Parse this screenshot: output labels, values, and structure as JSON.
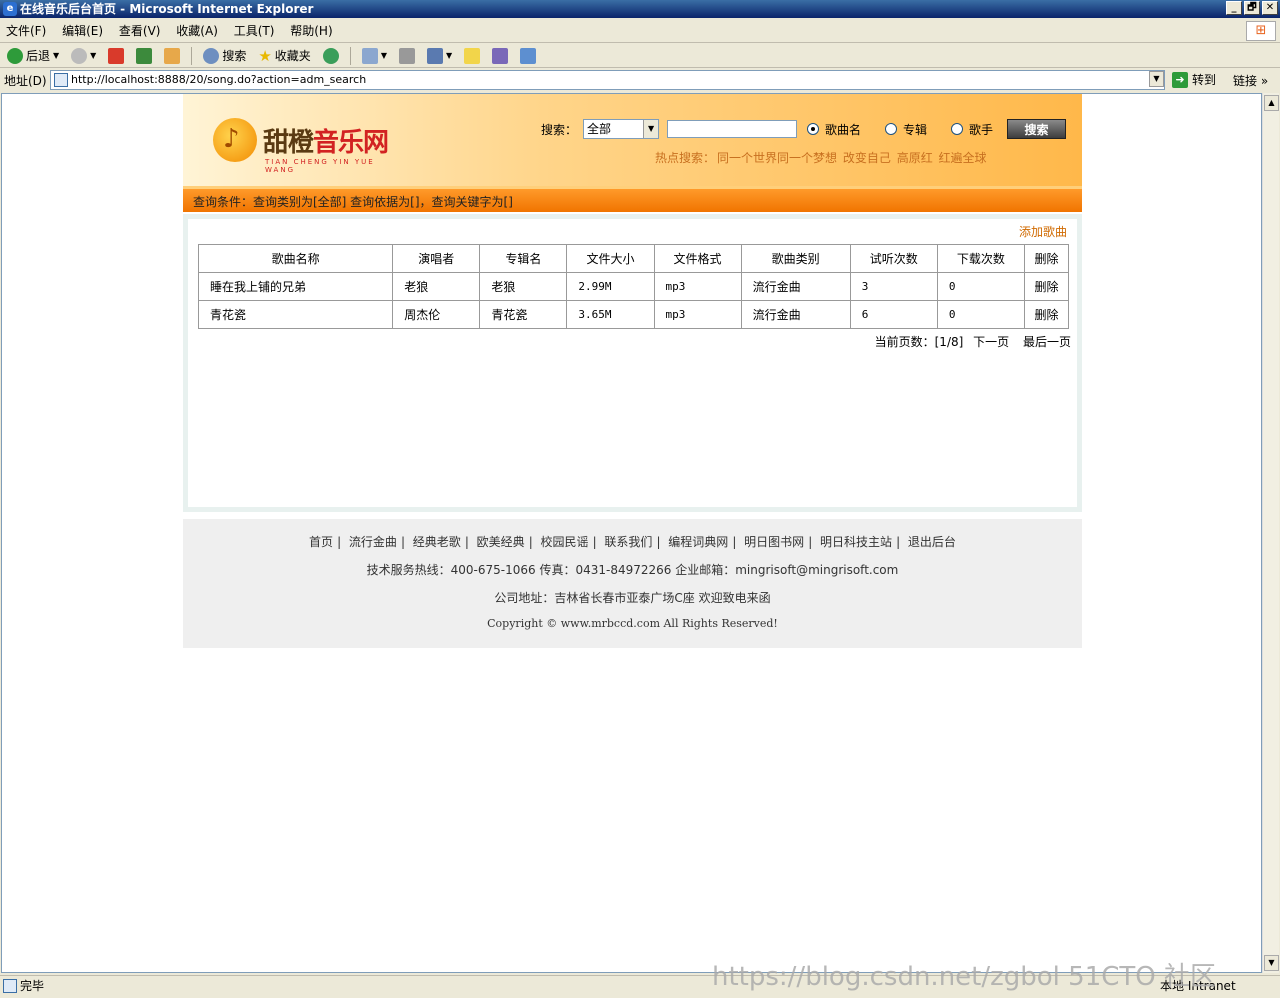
{
  "window": {
    "title": "在线音乐后台首页 - Microsoft Internet Explorer",
    "min_btn": "_",
    "max_btn": "🗗",
    "close_btn": "✕"
  },
  "menubar": [
    "文件(F)",
    "编辑(E)",
    "查看(V)",
    "收藏(A)",
    "工具(T)",
    "帮助(H)"
  ],
  "toolbar": {
    "back_label": "后退",
    "search_label": "搜索",
    "favorites_label": "收藏夹"
  },
  "addressbar": {
    "label": "地址(D)",
    "url": "http://localhost:8888/20/song.do?action=adm_search",
    "go_label": "转到",
    "links_label": "链接"
  },
  "header": {
    "logo_cn_1": "甜橙",
    "logo_cn_2": "音乐网",
    "logo_en": "TIAN CHENG YIN YUE WANG",
    "search_label": "搜索：",
    "select_value": "全部",
    "radio_song": "歌曲名",
    "radio_album": "专辑",
    "radio_singer": "歌手",
    "search_btn": "搜索",
    "hot_label": "热点搜索：",
    "hot_items": [
      "同一个世界同一个梦想",
      "改变自己",
      "高原红",
      "红遍全球"
    ]
  },
  "condition": "查询条件：查询类别为[全部] 查询依据为[]，查询关键字为[]",
  "add_link": "添加歌曲",
  "table": {
    "headers": [
      "歌曲名称",
      "演唱者",
      "专辑名",
      "文件大小",
      "文件格式",
      "歌曲类别",
      "试听次数",
      "下载次数",
      "删除"
    ],
    "rows": [
      [
        "睡在我上铺的兄弟",
        "老狼",
        "老狼",
        "2.99M",
        "mp3",
        "流行金曲",
        "3",
        "0",
        "删除"
      ],
      [
        "青花瓷",
        "周杰伦",
        "青花瓷",
        "3.65M",
        "mp3",
        "流行金曲",
        "6",
        "0",
        "删除"
      ]
    ]
  },
  "pager": {
    "current": "当前页数：[1/8]",
    "next": "下一页",
    "last": "最后一页"
  },
  "footer": {
    "nav": [
      "首页",
      "流行金曲",
      "经典老歌",
      "欧美经典",
      "校园民谣",
      "联系我们",
      "编程词典网",
      "明日图书网",
      "明日科技主站",
      "退出后台"
    ],
    "line1": "技术服务热线：400-675-1066  传真：0431-84972266  企业邮箱：mingrisoft@mingrisoft.com",
    "line2": "公司地址：吉林省长春市亚泰广场C座  欢迎致电来函",
    "line3": "Copyright © www.mrbccd.com All Rights Reserved!"
  },
  "status": {
    "text": "完毕",
    "zone": "本地 Intranet"
  },
  "watermark": "https://blog.csdn.net/zgbol 51CTO 社区"
}
